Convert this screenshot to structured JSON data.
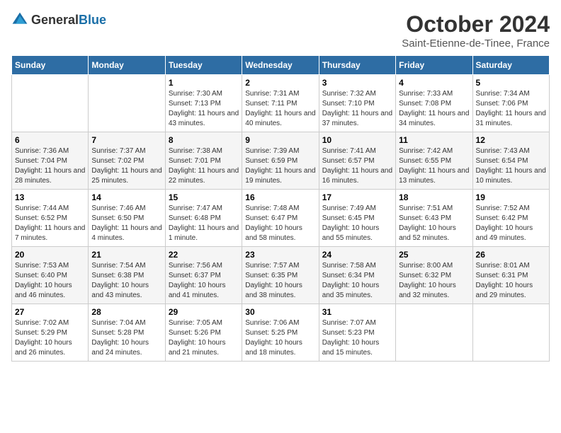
{
  "header": {
    "logo_general": "General",
    "logo_blue": "Blue",
    "month": "October 2024",
    "location": "Saint-Etienne-de-Tinee, France"
  },
  "days_of_week": [
    "Sunday",
    "Monday",
    "Tuesday",
    "Wednesday",
    "Thursday",
    "Friday",
    "Saturday"
  ],
  "weeks": [
    [
      {
        "day": "",
        "sunrise": "",
        "sunset": "",
        "daylight": ""
      },
      {
        "day": "",
        "sunrise": "",
        "sunset": "",
        "daylight": ""
      },
      {
        "day": "1",
        "sunrise": "Sunrise: 7:30 AM",
        "sunset": "Sunset: 7:13 PM",
        "daylight": "Daylight: 11 hours and 43 minutes."
      },
      {
        "day": "2",
        "sunrise": "Sunrise: 7:31 AM",
        "sunset": "Sunset: 7:11 PM",
        "daylight": "Daylight: 11 hours and 40 minutes."
      },
      {
        "day": "3",
        "sunrise": "Sunrise: 7:32 AM",
        "sunset": "Sunset: 7:10 PM",
        "daylight": "Daylight: 11 hours and 37 minutes."
      },
      {
        "day": "4",
        "sunrise": "Sunrise: 7:33 AM",
        "sunset": "Sunset: 7:08 PM",
        "daylight": "Daylight: 11 hours and 34 minutes."
      },
      {
        "day": "5",
        "sunrise": "Sunrise: 7:34 AM",
        "sunset": "Sunset: 7:06 PM",
        "daylight": "Daylight: 11 hours and 31 minutes."
      }
    ],
    [
      {
        "day": "6",
        "sunrise": "Sunrise: 7:36 AM",
        "sunset": "Sunset: 7:04 PM",
        "daylight": "Daylight: 11 hours and 28 minutes."
      },
      {
        "day": "7",
        "sunrise": "Sunrise: 7:37 AM",
        "sunset": "Sunset: 7:02 PM",
        "daylight": "Daylight: 11 hours and 25 minutes."
      },
      {
        "day": "8",
        "sunrise": "Sunrise: 7:38 AM",
        "sunset": "Sunset: 7:01 PM",
        "daylight": "Daylight: 11 hours and 22 minutes."
      },
      {
        "day": "9",
        "sunrise": "Sunrise: 7:39 AM",
        "sunset": "Sunset: 6:59 PM",
        "daylight": "Daylight: 11 hours and 19 minutes."
      },
      {
        "day": "10",
        "sunrise": "Sunrise: 7:41 AM",
        "sunset": "Sunset: 6:57 PM",
        "daylight": "Daylight: 11 hours and 16 minutes."
      },
      {
        "day": "11",
        "sunrise": "Sunrise: 7:42 AM",
        "sunset": "Sunset: 6:55 PM",
        "daylight": "Daylight: 11 hours and 13 minutes."
      },
      {
        "day": "12",
        "sunrise": "Sunrise: 7:43 AM",
        "sunset": "Sunset: 6:54 PM",
        "daylight": "Daylight: 11 hours and 10 minutes."
      }
    ],
    [
      {
        "day": "13",
        "sunrise": "Sunrise: 7:44 AM",
        "sunset": "Sunset: 6:52 PM",
        "daylight": "Daylight: 11 hours and 7 minutes."
      },
      {
        "day": "14",
        "sunrise": "Sunrise: 7:46 AM",
        "sunset": "Sunset: 6:50 PM",
        "daylight": "Daylight: 11 hours and 4 minutes."
      },
      {
        "day": "15",
        "sunrise": "Sunrise: 7:47 AM",
        "sunset": "Sunset: 6:48 PM",
        "daylight": "Daylight: 11 hours and 1 minute."
      },
      {
        "day": "16",
        "sunrise": "Sunrise: 7:48 AM",
        "sunset": "Sunset: 6:47 PM",
        "daylight": "Daylight: 10 hours and 58 minutes."
      },
      {
        "day": "17",
        "sunrise": "Sunrise: 7:49 AM",
        "sunset": "Sunset: 6:45 PM",
        "daylight": "Daylight: 10 hours and 55 minutes."
      },
      {
        "day": "18",
        "sunrise": "Sunrise: 7:51 AM",
        "sunset": "Sunset: 6:43 PM",
        "daylight": "Daylight: 10 hours and 52 minutes."
      },
      {
        "day": "19",
        "sunrise": "Sunrise: 7:52 AM",
        "sunset": "Sunset: 6:42 PM",
        "daylight": "Daylight: 10 hours and 49 minutes."
      }
    ],
    [
      {
        "day": "20",
        "sunrise": "Sunrise: 7:53 AM",
        "sunset": "Sunset: 6:40 PM",
        "daylight": "Daylight: 10 hours and 46 minutes."
      },
      {
        "day": "21",
        "sunrise": "Sunrise: 7:54 AM",
        "sunset": "Sunset: 6:38 PM",
        "daylight": "Daylight: 10 hours and 43 minutes."
      },
      {
        "day": "22",
        "sunrise": "Sunrise: 7:56 AM",
        "sunset": "Sunset: 6:37 PM",
        "daylight": "Daylight: 10 hours and 41 minutes."
      },
      {
        "day": "23",
        "sunrise": "Sunrise: 7:57 AM",
        "sunset": "Sunset: 6:35 PM",
        "daylight": "Daylight: 10 hours and 38 minutes."
      },
      {
        "day": "24",
        "sunrise": "Sunrise: 7:58 AM",
        "sunset": "Sunset: 6:34 PM",
        "daylight": "Daylight: 10 hours and 35 minutes."
      },
      {
        "day": "25",
        "sunrise": "Sunrise: 8:00 AM",
        "sunset": "Sunset: 6:32 PM",
        "daylight": "Daylight: 10 hours and 32 minutes."
      },
      {
        "day": "26",
        "sunrise": "Sunrise: 8:01 AM",
        "sunset": "Sunset: 6:31 PM",
        "daylight": "Daylight: 10 hours and 29 minutes."
      }
    ],
    [
      {
        "day": "27",
        "sunrise": "Sunrise: 7:02 AM",
        "sunset": "Sunset: 5:29 PM",
        "daylight": "Daylight: 10 hours and 26 minutes."
      },
      {
        "day": "28",
        "sunrise": "Sunrise: 7:04 AM",
        "sunset": "Sunset: 5:28 PM",
        "daylight": "Daylight: 10 hours and 24 minutes."
      },
      {
        "day": "29",
        "sunrise": "Sunrise: 7:05 AM",
        "sunset": "Sunset: 5:26 PM",
        "daylight": "Daylight: 10 hours and 21 minutes."
      },
      {
        "day": "30",
        "sunrise": "Sunrise: 7:06 AM",
        "sunset": "Sunset: 5:25 PM",
        "daylight": "Daylight: 10 hours and 18 minutes."
      },
      {
        "day": "31",
        "sunrise": "Sunrise: 7:07 AM",
        "sunset": "Sunset: 5:23 PM",
        "daylight": "Daylight: 10 hours and 15 minutes."
      },
      {
        "day": "",
        "sunrise": "",
        "sunset": "",
        "daylight": ""
      },
      {
        "day": "",
        "sunrise": "",
        "sunset": "",
        "daylight": ""
      }
    ]
  ]
}
